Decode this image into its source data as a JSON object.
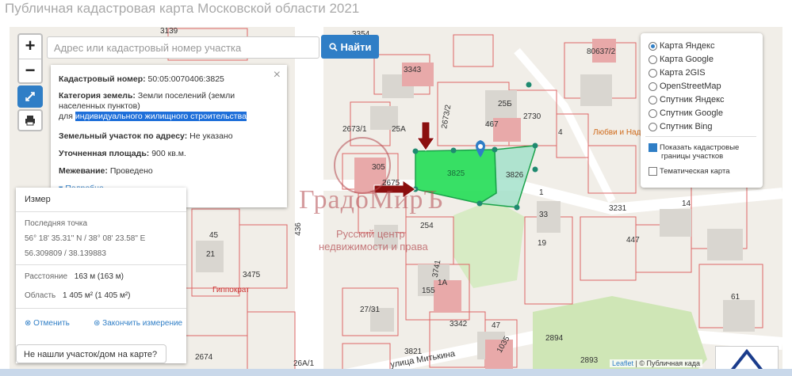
{
  "page_title": "Публичная кадастровая карта Московской области 2021",
  "controls": {
    "zoom_in": "+",
    "zoom_out": "−"
  },
  "search": {
    "placeholder": "Адрес или кадастровый номер участка",
    "button_label": "Найти"
  },
  "info": {
    "close": "×",
    "cad_label": "Кадастровый номер:",
    "cad_value": "50:05:0070406:3825",
    "cat_label": "Категория земель:",
    "cat_value": "Земли поселений (земли",
    "cat_value2": "населенных пунктов)",
    "use_prefix": "для",
    "use_value": "индивидуального жилищного строительства",
    "addr_label": "Земельный участок по адресу:",
    "addr_value": "Не указано",
    "area_label": "Уточненная площадь:",
    "area_value": "900 кв.м.",
    "survey_label": "Межевание:",
    "survey_value": "Проведено",
    "more": "Подробно"
  },
  "measure": {
    "title": "Измер",
    "last_point_label": "Последняя точка",
    "dms": "56° 18' 35.31\" N / 38° 08' 23.58\" E",
    "decimal": "56.309809 / 38.139883",
    "distance_label": "Расстояние",
    "distance_value": "163 м (163 м)",
    "area_label": "Область",
    "area_value": "1 405 м² (1 405 м²)",
    "cancel": "Отменить",
    "finish": "Закончить измерение"
  },
  "layers": {
    "base": [
      {
        "label": "Карта Яндекс",
        "selected": true
      },
      {
        "label": "Карта Google",
        "selected": false
      },
      {
        "label": "Карта 2GIS",
        "selected": false
      },
      {
        "label": "OpenStreetMap",
        "selected": false
      },
      {
        "label": "Спутник Яндекс",
        "selected": false
      },
      {
        "label": "Спутник Google",
        "selected": false
      },
      {
        "label": "Спутник Bing",
        "selected": false
      }
    ],
    "overlay_cadastral_1": "Показать кадастровые",
    "overlay_cadastral_2": "границы участков",
    "overlay_thematic": "Тематическая карта"
  },
  "not_found": "Не нашли участок/дом на карте?",
  "attribution": {
    "leaflet": "Leaflet",
    "sep": " | © ",
    "source": "Публичная када"
  },
  "watermark": {
    "brand": "ГрадоМирЪ",
    "line1": "Русский центр",
    "line2": "недвижимости и права"
  },
  "map_labels": [
    "3139",
    "3354",
    "3343",
    "80637/2",
    "2673/1",
    "25А",
    "2673/2",
    "25Б",
    "467",
    "2730",
    "4",
    "3825",
    "3826",
    "305",
    "2675",
    "254",
    "33",
    "1",
    "3231",
    "3475",
    "Гиппократ",
    "21",
    "45",
    "436",
    "155",
    "3741",
    "1А",
    "27/31",
    "19",
    "447",
    "3342",
    "47",
    "1035",
    "61",
    "3821",
    "2674",
    "26А/1",
    "2894",
    "2893",
    "Любви и Наде",
    "улица Митькина",
    "3",
    "36",
    "21",
    "14"
  ],
  "colors": {
    "accent": "#2f7ec6",
    "parcel": "#22cc55",
    "selected": "#1e6fd9"
  }
}
